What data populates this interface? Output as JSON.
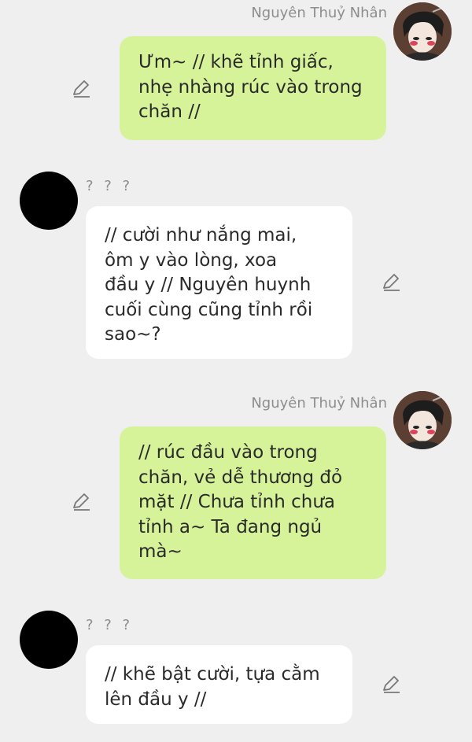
{
  "messages": [
    {
      "sender": "Nguyên Thuỷ Nhân",
      "side": "right",
      "text": "Ưm~ // khẽ tỉnh giấc,\nnhẹ nhàng rúc vào trong\nchăn //"
    },
    {
      "sender": "? ? ?",
      "side": "left",
      "text": "// cười như nắng mai,\nôm y vào lòng, xoa\nđầu y // Nguyên huynh\ncuối cùng cũng tỉnh rồi\nsao~?"
    },
    {
      "sender": "Nguyên Thuỷ Nhân",
      "side": "right",
      "text": "// rúc đầu vào trong\nchăn, vẻ dễ thương đỏ\nmặt // Chưa tỉnh chưa\ntỉnh a~ Ta đang ngủ\nmà~"
    },
    {
      "sender": "? ? ?",
      "side": "left",
      "text": "// khẽ bật cười, tựa cằm\nlên đầu y //"
    }
  ],
  "icons": {
    "edit": "pencil-icon",
    "user_avatar": "anime-character-avatar",
    "other_avatar": "black-circle-avatar"
  },
  "colors": {
    "background": "#efefef",
    "user_bubble": "#d6f39a",
    "other_bubble": "#ffffff",
    "name_text": "#8d8d8d"
  }
}
